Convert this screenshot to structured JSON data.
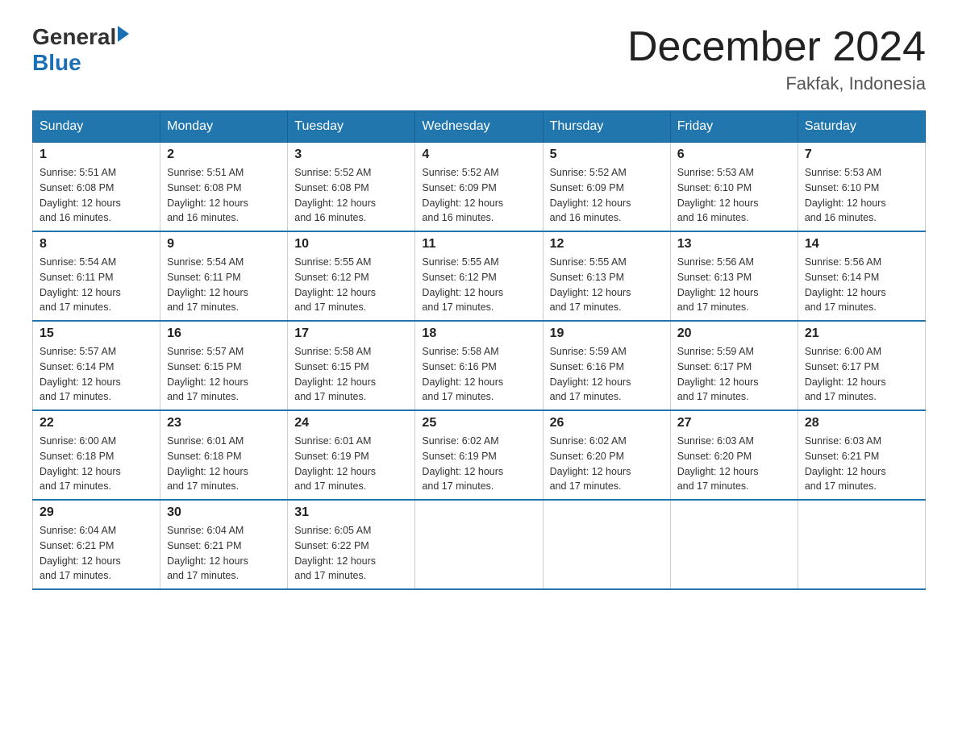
{
  "header": {
    "logo_general": "General",
    "logo_blue": "Blue",
    "title": "December 2024",
    "location": "Fakfak, Indonesia"
  },
  "weekdays": [
    "Sunday",
    "Monday",
    "Tuesday",
    "Wednesday",
    "Thursday",
    "Friday",
    "Saturday"
  ],
  "weeks": [
    [
      {
        "day": "1",
        "sunrise": "5:51 AM",
        "sunset": "6:08 PM",
        "daylight": "12 hours and 16 minutes."
      },
      {
        "day": "2",
        "sunrise": "5:51 AM",
        "sunset": "6:08 PM",
        "daylight": "12 hours and 16 minutes."
      },
      {
        "day": "3",
        "sunrise": "5:52 AM",
        "sunset": "6:08 PM",
        "daylight": "12 hours and 16 minutes."
      },
      {
        "day": "4",
        "sunrise": "5:52 AM",
        "sunset": "6:09 PM",
        "daylight": "12 hours and 16 minutes."
      },
      {
        "day": "5",
        "sunrise": "5:52 AM",
        "sunset": "6:09 PM",
        "daylight": "12 hours and 16 minutes."
      },
      {
        "day": "6",
        "sunrise": "5:53 AM",
        "sunset": "6:10 PM",
        "daylight": "12 hours and 16 minutes."
      },
      {
        "day": "7",
        "sunrise": "5:53 AM",
        "sunset": "6:10 PM",
        "daylight": "12 hours and 16 minutes."
      }
    ],
    [
      {
        "day": "8",
        "sunrise": "5:54 AM",
        "sunset": "6:11 PM",
        "daylight": "12 hours and 17 minutes."
      },
      {
        "day": "9",
        "sunrise": "5:54 AM",
        "sunset": "6:11 PM",
        "daylight": "12 hours and 17 minutes."
      },
      {
        "day": "10",
        "sunrise": "5:55 AM",
        "sunset": "6:12 PM",
        "daylight": "12 hours and 17 minutes."
      },
      {
        "day": "11",
        "sunrise": "5:55 AM",
        "sunset": "6:12 PM",
        "daylight": "12 hours and 17 minutes."
      },
      {
        "day": "12",
        "sunrise": "5:55 AM",
        "sunset": "6:13 PM",
        "daylight": "12 hours and 17 minutes."
      },
      {
        "day": "13",
        "sunrise": "5:56 AM",
        "sunset": "6:13 PM",
        "daylight": "12 hours and 17 minutes."
      },
      {
        "day": "14",
        "sunrise": "5:56 AM",
        "sunset": "6:14 PM",
        "daylight": "12 hours and 17 minutes."
      }
    ],
    [
      {
        "day": "15",
        "sunrise": "5:57 AM",
        "sunset": "6:14 PM",
        "daylight": "12 hours and 17 minutes."
      },
      {
        "day": "16",
        "sunrise": "5:57 AM",
        "sunset": "6:15 PM",
        "daylight": "12 hours and 17 minutes."
      },
      {
        "day": "17",
        "sunrise": "5:58 AM",
        "sunset": "6:15 PM",
        "daylight": "12 hours and 17 minutes."
      },
      {
        "day": "18",
        "sunrise": "5:58 AM",
        "sunset": "6:16 PM",
        "daylight": "12 hours and 17 minutes."
      },
      {
        "day": "19",
        "sunrise": "5:59 AM",
        "sunset": "6:16 PM",
        "daylight": "12 hours and 17 minutes."
      },
      {
        "day": "20",
        "sunrise": "5:59 AM",
        "sunset": "6:17 PM",
        "daylight": "12 hours and 17 minutes."
      },
      {
        "day": "21",
        "sunrise": "6:00 AM",
        "sunset": "6:17 PM",
        "daylight": "12 hours and 17 minutes."
      }
    ],
    [
      {
        "day": "22",
        "sunrise": "6:00 AM",
        "sunset": "6:18 PM",
        "daylight": "12 hours and 17 minutes."
      },
      {
        "day": "23",
        "sunrise": "6:01 AM",
        "sunset": "6:18 PM",
        "daylight": "12 hours and 17 minutes."
      },
      {
        "day": "24",
        "sunrise": "6:01 AM",
        "sunset": "6:19 PM",
        "daylight": "12 hours and 17 minutes."
      },
      {
        "day": "25",
        "sunrise": "6:02 AM",
        "sunset": "6:19 PM",
        "daylight": "12 hours and 17 minutes."
      },
      {
        "day": "26",
        "sunrise": "6:02 AM",
        "sunset": "6:20 PM",
        "daylight": "12 hours and 17 minutes."
      },
      {
        "day": "27",
        "sunrise": "6:03 AM",
        "sunset": "6:20 PM",
        "daylight": "12 hours and 17 minutes."
      },
      {
        "day": "28",
        "sunrise": "6:03 AM",
        "sunset": "6:21 PM",
        "daylight": "12 hours and 17 minutes."
      }
    ],
    [
      {
        "day": "29",
        "sunrise": "6:04 AM",
        "sunset": "6:21 PM",
        "daylight": "12 hours and 17 minutes."
      },
      {
        "day": "30",
        "sunrise": "6:04 AM",
        "sunset": "6:21 PM",
        "daylight": "12 hours and 17 minutes."
      },
      {
        "day": "31",
        "sunrise": "6:05 AM",
        "sunset": "6:22 PM",
        "daylight": "12 hours and 17 minutes."
      },
      null,
      null,
      null,
      null
    ]
  ],
  "labels": {
    "sunrise": "Sunrise:",
    "sunset": "Sunset:",
    "daylight": "Daylight:"
  }
}
